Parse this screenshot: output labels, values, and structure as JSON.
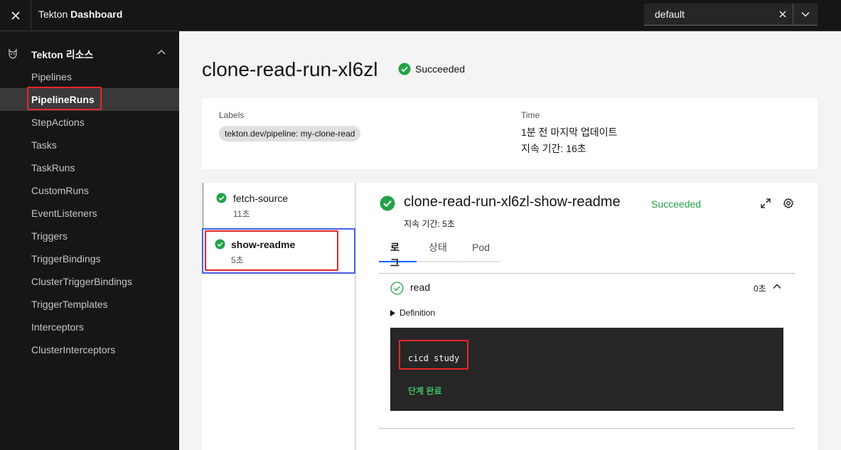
{
  "header": {
    "brand_prefix": "Tekton",
    "brand_bold": "Dashboard",
    "namespace_value": "default"
  },
  "sidebar": {
    "group_label": "Tekton 리소스",
    "items": [
      {
        "label": "Pipelines"
      },
      {
        "label": "PipelineRuns",
        "active": true
      },
      {
        "label": "StepActions"
      },
      {
        "label": "Tasks"
      },
      {
        "label": "TaskRuns"
      },
      {
        "label": "CustomRuns"
      },
      {
        "label": "EventListeners"
      },
      {
        "label": "Triggers"
      },
      {
        "label": "TriggerBindings"
      },
      {
        "label": "ClusterTriggerBindings"
      },
      {
        "label": "TriggerTemplates"
      },
      {
        "label": "Interceptors"
      },
      {
        "label": "ClusterInterceptors"
      }
    ]
  },
  "run": {
    "title": "clone-read-run-xl6zl",
    "status": "Succeeded"
  },
  "info": {
    "labels_heading": "Labels",
    "label_tag": "tekton.dev/pipeline: my-clone-read",
    "time_heading": "Time",
    "updated": "1분 전 마지막 업데이트",
    "duration": "지속 기간: 16초"
  },
  "tasks": [
    {
      "name": "fetch-source",
      "duration": "11초"
    },
    {
      "name": "show-readme",
      "duration": "5초"
    }
  ],
  "detail": {
    "title": "clone-read-run-xl6zl-show-readme",
    "status": "Succeeded",
    "duration": "지속 기간: 5초",
    "tabs": [
      "로그",
      "상태",
      "Pod"
    ],
    "step": {
      "name": "read",
      "duration": "0초",
      "definition_label": "Definition",
      "log_line": "cicd study",
      "log_done": "단계 완료"
    }
  },
  "colors": {
    "success": "#24a148",
    "highlight": "#e8262b",
    "selected_border": "#4a5ee8",
    "tab_active": "#0f62fe"
  }
}
